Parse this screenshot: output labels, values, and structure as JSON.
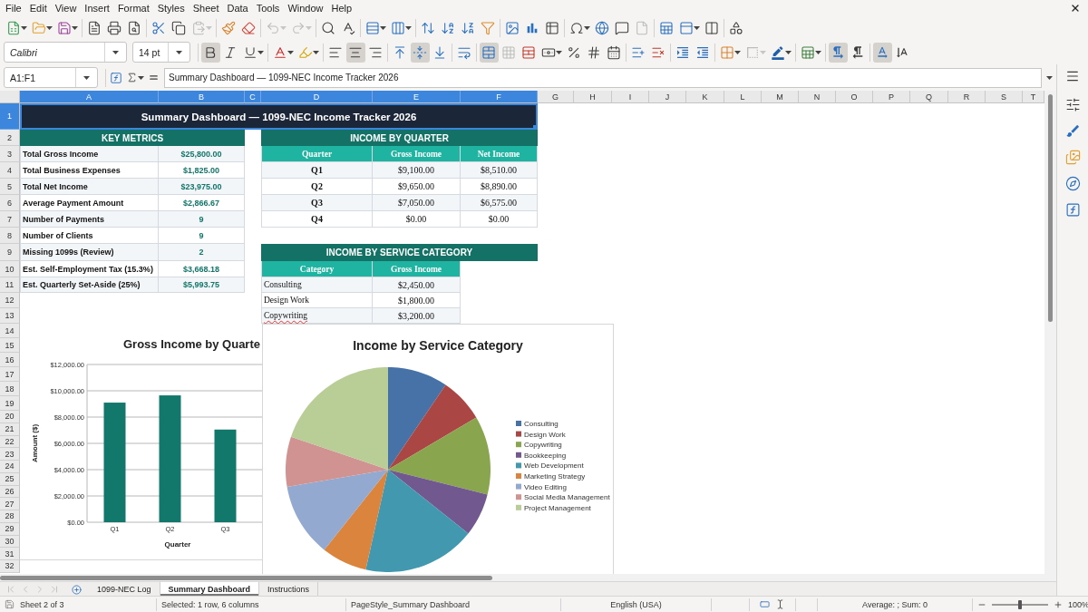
{
  "menu_bar": {
    "items": [
      "File",
      "Edit",
      "View",
      "Insert",
      "Format",
      "Styles",
      "Sheet",
      "Data",
      "Tools",
      "Window",
      "Help"
    ]
  },
  "standard_toolbar": [
    {
      "disabled": false
    },
    {
      "disabled": false
    },
    {
      "disabled": false
    },
    {
      "disabled": false
    },
    {
      "disabled": false
    },
    {
      "disabled": false
    },
    {
      "disabled": false
    },
    {
      "disabled": false
    },
    {
      "disabled": true
    },
    {
      "disabled": false
    },
    {
      "disabled": false
    },
    {
      "disabled": true
    },
    {
      "disabled": true
    },
    {
      "disabled": false
    },
    {
      "disabled": false
    },
    {
      "disabled": false
    },
    {
      "disabled": false
    },
    {
      "disabled": false
    },
    {
      "disabled": false
    },
    {
      "disabled": false
    },
    {
      "disabled": false
    },
    {
      "disabled": false
    },
    {
      "disabled": false
    },
    {
      "disabled": false
    },
    {
      "disabled": false
    },
    {
      "disabled": false
    },
    {
      "disabled": false
    },
    {
      "disabled": true
    },
    {
      "disabled": false
    },
    {
      "disabled": false
    },
    {
      "disabled": false
    },
    {
      "disabled": false
    }
  ],
  "formatting_toolbar": {
    "font_name": "Calibri",
    "font_size": "14 pt",
    "buttons": [
      {
        "selected": true,
        "disabled": false
      },
      {
        "selected": false,
        "disabled": false
      },
      {
        "selected": false,
        "disabled": false
      },
      {
        "selected": false,
        "disabled": false
      },
      {
        "selected": false,
        "disabled": false
      },
      {
        "selected": false,
        "disabled": false
      },
      {
        "selected": true,
        "disabled": false
      },
      {
        "selected": false,
        "disabled": false
      },
      {
        "selected": false,
        "disabled": false
      },
      {
        "selected": true,
        "disabled": false
      },
      {
        "selected": false,
        "disabled": false
      },
      {
        "selected": false,
        "disabled": false
      },
      {
        "selected": true,
        "disabled": false
      },
      {
        "selected": false,
        "disabled": true
      },
      {
        "selected": false,
        "disabled": false
      },
      {
        "selected": false,
        "disabled": false
      },
      {
        "selected": false,
        "disabled": false
      },
      {
        "selected": false,
        "disabled": false
      },
      {
        "selected": false,
        "disabled": false
      },
      {
        "selected": false,
        "disabled": false
      },
      {
        "selected": false,
        "disabled": false
      },
      {
        "selected": false,
        "disabled": false
      },
      {
        "selected": false,
        "disabled": false
      },
      {
        "selected": false,
        "disabled": false
      },
      {
        "selected": false,
        "disabled": true
      },
      {
        "selected": false,
        "disabled": false
      },
      {
        "selected": false,
        "disabled": false
      },
      {
        "selected": true,
        "disabled": false
      },
      {
        "selected": false,
        "disabled": false
      },
      {
        "selected": true,
        "disabled": false
      },
      {
        "selected": false,
        "disabled": false
      }
    ]
  },
  "formula_bar": {
    "name_box": "A1:F1",
    "formula": "Summary Dashboard — 1099-NEC Income Tracker 2026"
  },
  "sheet": {
    "columns": [
      {
        "label": "A",
        "selected": true
      },
      {
        "label": "B",
        "selected": true
      },
      {
        "label": "C",
        "selected": true
      },
      {
        "label": "D",
        "selected": true
      },
      {
        "label": "E",
        "selected": true
      },
      {
        "label": "F",
        "selected": true
      },
      {
        "label": "G",
        "selected": false
      },
      {
        "label": "H",
        "selected": false
      },
      {
        "label": "I",
        "selected": false
      },
      {
        "label": "J",
        "selected": false
      },
      {
        "label": "K",
        "selected": false
      },
      {
        "label": "L",
        "selected": false
      },
      {
        "label": "M",
        "selected": false
      },
      {
        "label": "N",
        "selected": false
      },
      {
        "label": "O",
        "selected": false
      },
      {
        "label": "P",
        "selected": false
      },
      {
        "label": "Q",
        "selected": false
      },
      {
        "label": "R",
        "selected": false
      },
      {
        "label": "S",
        "selected": false
      },
      {
        "label": "T",
        "selected": false
      }
    ],
    "rows": [
      {
        "label": "1",
        "selected": true
      },
      {
        "label": "2",
        "selected": false
      },
      {
        "label": "3",
        "selected": false
      },
      {
        "label": "4",
        "selected": false
      },
      {
        "label": "5",
        "selected": false
      },
      {
        "label": "6",
        "selected": false
      },
      {
        "label": "7",
        "selected": false
      },
      {
        "label": "8",
        "selected": false
      },
      {
        "label": "9",
        "selected": false
      },
      {
        "label": "10",
        "selected": false
      },
      {
        "label": "11",
        "selected": false
      },
      {
        "label": "12",
        "selected": false
      },
      {
        "label": "13",
        "selected": false
      },
      {
        "label": "14",
        "selected": false
      },
      {
        "label": "15",
        "selected": false
      },
      {
        "label": "16",
        "selected": false
      },
      {
        "label": "17",
        "selected": false
      },
      {
        "label": "18",
        "selected": false
      },
      {
        "label": "19",
        "selected": false
      },
      {
        "label": "20",
        "selected": false
      },
      {
        "label": "21",
        "selected": false
      },
      {
        "label": "22",
        "selected": false
      },
      {
        "label": "23",
        "selected": false
      },
      {
        "label": "24",
        "selected": false
      },
      {
        "label": "25",
        "selected": false
      },
      {
        "label": "26",
        "selected": false
      },
      {
        "label": "27",
        "selected": false
      },
      {
        "label": "28",
        "selected": false
      },
      {
        "label": "29",
        "selected": false
      },
      {
        "label": "30",
        "selected": false
      },
      {
        "label": "31",
        "selected": false
      },
      {
        "label": "32",
        "selected": false
      }
    ],
    "title_banner": {
      "text": "Summary Dashboard — 1099-NEC Income Tracker 2026",
      "selected": true
    },
    "key_metrics": {
      "heading": "KEY METRICS",
      "rows": [
        {
          "label": "Total Gross Income",
          "value": "$25,800.00"
        },
        {
          "label": "Total Business Expenses",
          "value": "$1,825.00"
        },
        {
          "label": "Total Net Income",
          "value": "$23,975.00"
        },
        {
          "label": "Average Payment Amount",
          "value": "$2,866.67"
        },
        {
          "label": "Number of Payments",
          "value": "9"
        },
        {
          "label": "Number of Clients",
          "value": "9"
        },
        {
          "label": "Missing 1099s (Review)",
          "value": "2"
        },
        {
          "label": "Est. Self-Employment Tax (15.3%)",
          "value": "$3,668.18"
        },
        {
          "label": "Est. Quarterly Set-Aside (25%)",
          "value": "$5,993.75"
        }
      ]
    },
    "income_by_quarter": {
      "heading": "INCOME BY QUARTER",
      "columns": [
        "Quarter",
        "Gross Income",
        "Net Income"
      ],
      "rows": [
        {
          "quarter": "Q1",
          "gross": "$9,100.00",
          "net": "$8,510.00"
        },
        {
          "quarter": "Q2",
          "gross": "$9,650.00",
          "net": "$8,890.00"
        },
        {
          "quarter": "Q3",
          "gross": "$7,050.00",
          "net": "$6,575.00"
        },
        {
          "quarter": "Q4",
          "gross": "$0.00",
          "net": "$0.00"
        }
      ]
    },
    "income_by_category": {
      "heading": "INCOME BY SERVICE CATEGORY",
      "columns": [
        "Category",
        "Gross Income"
      ],
      "rows": [
        {
          "category": "Consulting",
          "gross": "$2,450.00",
          "spelling_flag": false
        },
        {
          "category": "Design Work",
          "gross": "$1,800.00",
          "spelling_flag": false
        },
        {
          "category": "Copywriting",
          "gross": "$3,200.00",
          "spelling_flag": true
        }
      ]
    }
  },
  "charts": [
    {
      "chart_data": {
        "type": "bar",
        "title": "Gross Income by Quarte",
        "xlabel": "Quarter",
        "ylabel": "Amount ($)",
        "categories": [
          "Q1",
          "Q2",
          "Q3"
        ],
        "series": [
          {
            "color": "#12786c",
            "values": [
              9100,
              9650,
              7050
            ]
          }
        ],
        "ylim": [
          0,
          12000
        ],
        "yticks": [
          {
            "value": 0,
            "label": "$0.00"
          },
          {
            "value": 2000,
            "label": "$2,000.00"
          },
          {
            "value": 4000,
            "label": "$4,000.00"
          },
          {
            "value": 6000,
            "label": "$6,000.00"
          },
          {
            "value": 8000,
            "label": "$8,000.00"
          },
          {
            "value": 10000,
            "label": "$10,000.00"
          },
          {
            "value": 12000,
            "label": "$12,000.00"
          }
        ],
        "grid": true
      }
    },
    {
      "chart_data": {
        "type": "pie",
        "title": "Income by Service Category",
        "categories": [
          "Consulting",
          "Design Work",
          "Copywriting",
          "Bookkeeping",
          "Web Development",
          "Marketing Strategy",
          "Video Editing",
          "Social Media Management",
          "Project Management"
        ],
        "values": [
          9.5,
          7,
          12.4,
          6.8,
          17.8,
          7.2,
          11.6,
          7.9,
          19.8
        ],
        "legend": "right"
      },
      "slices": [
        {
          "color": "#4672a8"
        },
        {
          "color": "#aa4643"
        },
        {
          "color": "#89a54e"
        },
        {
          "color": "#71588f"
        },
        {
          "color": "#4198af"
        },
        {
          "color": "#db843d"
        },
        {
          "color": "#93a9cf"
        },
        {
          "color": "#d19392"
        },
        {
          "color": "#b9cd96"
        }
      ]
    }
  ],
  "sheet_tabs": {
    "navigation": [
      {
        "disabled": true
      },
      {
        "disabled": true
      },
      {
        "disabled": true
      },
      {
        "disabled": true
      }
    ],
    "tabs": [
      {
        "label": "1099-NEC Log",
        "selected": false
      },
      {
        "label": "Summary Dashboard",
        "selected": true
      },
      {
        "label": "Instructions",
        "selected": false
      }
    ]
  },
  "status_bar": {
    "sheet_position": "Sheet 2 of 3",
    "selection": "Selected: 1 row, 6 columns",
    "page_style": "PageStyle_Summary Dashboard",
    "language": "English (USA)",
    "summary": "Average: ; Sum: 0",
    "zoom": {
      "level": 0.5,
      "reading": "100%"
    }
  }
}
